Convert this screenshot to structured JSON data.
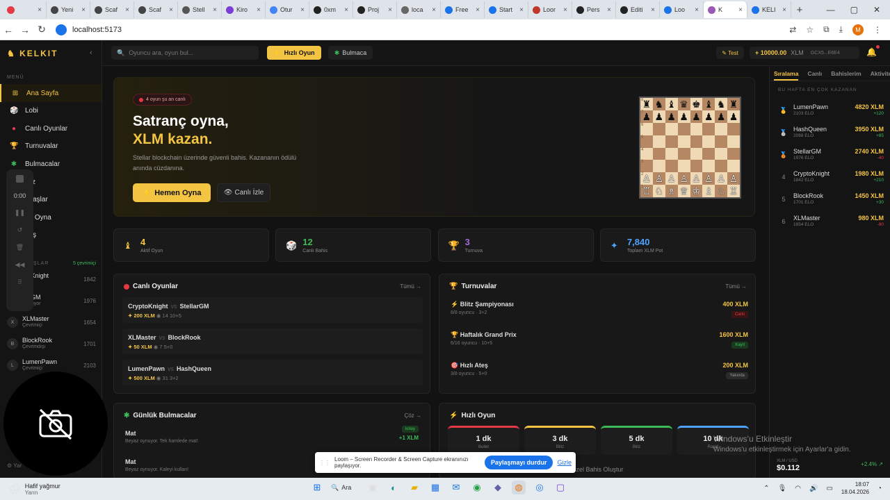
{
  "browser": {
    "tabs": [
      {
        "label": "",
        "color": "#e63946"
      },
      {
        "label": "Yeni",
        "color": "#444"
      },
      {
        "label": "Scaf",
        "color": "#444"
      },
      {
        "label": "Scaf",
        "color": "#444"
      },
      {
        "label": "Stell",
        "color": "#555"
      },
      {
        "label": "Kiro",
        "color": "#7a3ed6"
      },
      {
        "label": "Otur",
        "color": "#4285f4"
      },
      {
        "label": "0xm",
        "color": "#222"
      },
      {
        "label": "Proj",
        "color": "#222"
      },
      {
        "label": "loca",
        "color": "#666"
      },
      {
        "label": "Free",
        "color": "#1a73e8"
      },
      {
        "label": "Start",
        "color": "#1a73e8"
      },
      {
        "label": "Loor",
        "color": "#c0392b"
      },
      {
        "label": "Pers",
        "color": "#222"
      },
      {
        "label": "Editi",
        "color": "#222"
      },
      {
        "label": "Loo",
        "color": "#1a73e8"
      },
      {
        "label": "K",
        "color": "#9b59b6"
      },
      {
        "label": "KELI",
        "color": "#1a73e8"
      }
    ],
    "active_tab_index": 16,
    "url": "localhost:5173",
    "profile_initial": "M"
  },
  "app": {
    "logo": "KELKIT",
    "search_placeholder": "Oyuncu ara, oyun bul...",
    "quick_play": "Hızlı Oyun",
    "puzzle": "Bulmaca",
    "test": "Test",
    "balance": "+ 10000.00",
    "balance_unit": "XLM",
    "wallet": "GCX5...E6E4"
  },
  "sidebar": {
    "menu_title": "MENÜ",
    "items": [
      {
        "label": "Ana Sayfa",
        "icon": "⊞",
        "color": "#f4c542"
      },
      {
        "label": "Lobi",
        "icon": "🎲",
        "color": "#ddd"
      },
      {
        "label": "Canlı Oyunlar",
        "icon": "●",
        "color": "#e63946"
      },
      {
        "label": "Turnuvalar",
        "icon": "🏆",
        "color": "#f4c542"
      },
      {
        "label": "Bulmacalar",
        "icon": "✱",
        "color": "#3dbb5a"
      },
      {
        "label": "aliz",
        "icon": "",
        "color": "#ddd"
      },
      {
        "label": "adaşlar",
        "icon": "",
        "color": "#ddd"
      },
      {
        "label": "an Oyna",
        "icon": "",
        "color": "#ddd"
      },
      {
        "label": "mış",
        "icon": "",
        "color": "#ddd"
      }
    ],
    "online_title": "ŞLAR",
    "online_count": "5 çevrimiçi",
    "players": [
      {
        "initial": "",
        "name": "ptoKnight",
        "status": "rimiçi",
        "elo": "1842"
      },
      {
        "initial": "",
        "name": "llarGM",
        "status": "Oynuyor",
        "elo": "1976"
      },
      {
        "initial": "X",
        "name": "XLMaster",
        "status": "Çevrimiçi",
        "elo": "1654"
      },
      {
        "initial": "B",
        "name": "BlockRook",
        "status": "Çevrimdışı",
        "elo": "1701"
      },
      {
        "initial": "L",
        "name": "LumenPawn",
        "status": "Çevrimiçi",
        "elo": "2103"
      }
    ],
    "settings_label": "Yar",
    "loom_time": "0:00"
  },
  "hero": {
    "badge": "4 oyun şu an canlı",
    "title_line1": "Satranç oyna,",
    "title_line2": "XLM kazan.",
    "desc": "Stellar blockchain üzerinde güvenli bahis. Kazananın ödülü anında cüzdanına.",
    "play_btn": "Hemen Oyna",
    "watch_btn": "Canlı İzle",
    "ranks": [
      "8",
      "7",
      "6",
      "5",
      "4",
      "3",
      "2",
      "1"
    ]
  },
  "stats": [
    {
      "value": "4",
      "label": "Aktif Oyun",
      "icon": "♝",
      "color": "#f4c542"
    },
    {
      "value": "12",
      "label": "Canlı Bahis",
      "icon": "🎲",
      "color": "#3dbb5a"
    },
    {
      "value": "3",
      "label": "Turnuva",
      "icon": "🏆",
      "color": "#a06bd6"
    },
    {
      "value": "7,840",
      "label": "Toplam XLM Pot",
      "icon": "✦",
      "color": "#4da3ff"
    }
  ],
  "live_games": {
    "title": "Canlı Oyunlar",
    "all": "Tümü →",
    "games": [
      {
        "p1": "CryptoKnight",
        "p2": "StellarGM",
        "bet": "✦ 200 XLM",
        "viewers": "◉ 14",
        "tc": "10+5"
      },
      {
        "p1": "XLMaster",
        "p2": "BlockRook",
        "bet": "✦ 50 XLM",
        "viewers": "◉ 7",
        "tc": "5+0"
      },
      {
        "p1": "LumenPawn",
        "p2": "HashQueen",
        "bet": "✦ 500 XLM",
        "viewers": "◉ 31",
        "tc": "3+2"
      }
    ]
  },
  "tournaments": {
    "title": "Turnuvalar",
    "all": "Tümü →",
    "items": [
      {
        "name": "Blitz Şampiyonası",
        "info": "8/8 oyuncu · 3+2",
        "prize": "400 XLM",
        "status": "Canlı",
        "bg": "#3a1414",
        "fg": "#e63946",
        "icon": "⚡",
        "icolor": "#f4c542"
      },
      {
        "name": "Haftalık Grand Prix",
        "info": "6/16 oyuncu · 10+5",
        "prize": "1600 XLM",
        "status": "Kayıt",
        "bg": "#1a3a1f",
        "fg": "#3dbb5a",
        "icon": "🏆",
        "icolor": "#f4c542"
      },
      {
        "name": "Hızlı Ateş",
        "info": "3/8 oyuncu · 5+0",
        "prize": "200 XLM",
        "status": "Yakında",
        "bg": "#2a2a2a",
        "fg": "#999",
        "icon": "🎯",
        "icolor": "#e63946"
      }
    ]
  },
  "puzzles": {
    "title": "Günlük Bulmacalar",
    "solve": "Çöz →",
    "items": [
      {
        "name": "Mat",
        "desc": "Beyaz oynuyor. Tek hamlede mat!",
        "diff": "kolay",
        "reward": "+1 XLM"
      },
      {
        "name": "Mat",
        "desc": "Beyaz oynuyor. Kaleyi kullan!",
        "diff": "",
        "reward": ""
      }
    ]
  },
  "quick_game": {
    "title": "Hızlı Oyun",
    "options": [
      {
        "time": "1 dk",
        "type": "Bullet",
        "color": "#e63946"
      },
      {
        "time": "3 dk",
        "type": "Blitz",
        "color": "#f4c542"
      },
      {
        "time": "5 dk",
        "type": "Blitz",
        "color": "#3dbb5a"
      },
      {
        "time": "10 dk",
        "type": "Rapid",
        "color": "#4da3ff"
      }
    ],
    "custom": "Özel Bahis Oluştur"
  },
  "leaderboard": {
    "tabs": [
      "Sıralama",
      "Canlı",
      "Bahislerim",
      "Aktivite"
    ],
    "subtitle": "BU HAFTA EN ÇOK KAZANAN",
    "rows": [
      {
        "rank": "🥇",
        "name": "LumenPawn",
        "elo": "2103 ELO",
        "xlm": "4820 XLM",
        "change": "+120",
        "cc": "#3dbb5a"
      },
      {
        "rank": "🥈",
        "name": "HashQueen",
        "elo": "2088 ELO",
        "xlm": "3950 XLM",
        "change": "+85",
        "cc": "#3dbb5a"
      },
      {
        "rank": "🥉",
        "name": "StellarGM",
        "elo": "1976 ELO",
        "xlm": "2740 XLM",
        "change": "-40",
        "cc": "#e63946"
      },
      {
        "rank": "4",
        "name": "CryptoKnight",
        "elo": "1842 ELO",
        "xlm": "1980 XLM",
        "change": "+210",
        "cc": "#3dbb5a"
      },
      {
        "rank": "5",
        "name": "BlockRook",
        "elo": "1701 ELO",
        "xlm": "1450 XLM",
        "change": "+30",
        "cc": "#3dbb5a"
      },
      {
        "rank": "6",
        "name": "XLMaster",
        "elo": "1654 ELO",
        "xlm": "980 XLM",
        "change": "-90",
        "cc": "#e63946"
      }
    ],
    "price_label": "XLM / USD",
    "price": "$0.112",
    "price_change": "+2.4% ↗"
  },
  "windows": {
    "watermark_line1": "Windows'u Etkinleştir",
    "watermark_line2": "Windows'u etkinleştirmek için Ayarlar'a gidin.",
    "weather_title": "Hafif yağmur",
    "weather_sub": "Yarın",
    "search": "Ara",
    "time": "18:07",
    "date": "18.04.2026"
  },
  "loom": {
    "message": "Loom – Screen Recorder & Screen Capture ekranınızı paylaşıyor.",
    "stop": "Paylaşmayı durdur",
    "hide": "Gizle"
  }
}
